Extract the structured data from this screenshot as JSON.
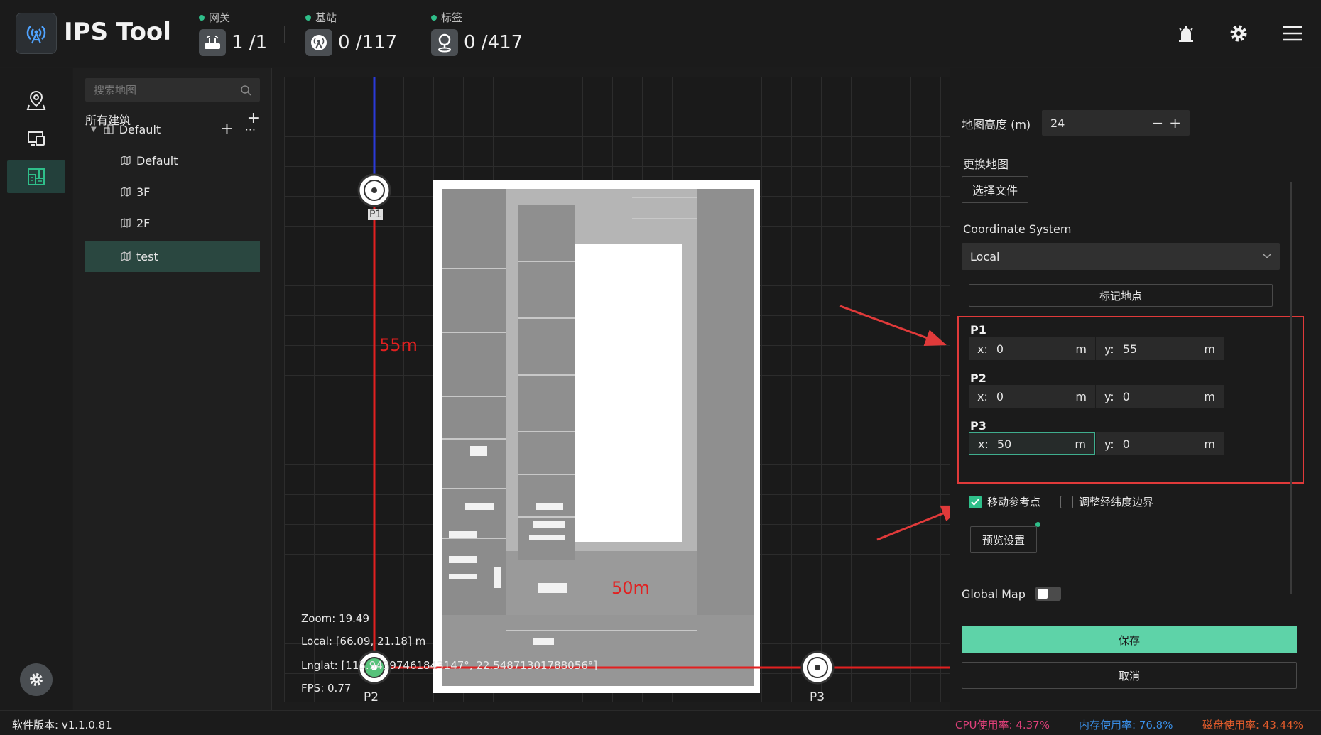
{
  "app": {
    "title": "IPS Tool"
  },
  "stats": [
    {
      "label": "网关",
      "value": "1 /1"
    },
    {
      "label": "基站",
      "value": "0 /117"
    },
    {
      "label": "标签",
      "value": "0 /417"
    }
  ],
  "tree": {
    "search_placeholder": "搜索地图",
    "header": "所有建筑",
    "building": "Default",
    "floors": [
      "Default",
      "3F",
      "2F",
      "test"
    ]
  },
  "map": {
    "labels": {
      "p1": "P1",
      "p2": "P2",
      "p3": "P3",
      "dim_y": "55m",
      "dim_x": "50m"
    },
    "info": {
      "zoom": "Zoom:  19.49",
      "local": "Local:  [66.09, 21.18] m",
      "lnglat": "Lnglat:  [113.94397461843147°, 22.54871301788056°]",
      "fps": "FPS:  0.77"
    }
  },
  "panel": {
    "map_height_label": "地图高度 (m)",
    "map_height_value": "24",
    "change_map_label": "更换地图",
    "choose_file": "选择文件",
    "coord_label": "Coordinate System",
    "coord_value": "Local",
    "mark_btn": "标记地点",
    "points": [
      {
        "name": "P1",
        "x": "0",
        "y": "55"
      },
      {
        "name": "P2",
        "x": "0",
        "y": "0"
      },
      {
        "name": "P3",
        "x": "50",
        "y": "0"
      }
    ],
    "x_prefix": "x:",
    "y_prefix": "y:",
    "unit": "m",
    "move_ref": "移动参考点",
    "adjust_bounds": "调整经纬度边界",
    "preview": "预览设置",
    "global_map": "Global Map",
    "save": "保存",
    "cancel": "取消"
  },
  "status": {
    "version": "软件版本: v1.1.0.81",
    "cpu": "CPU使用率: 4.37%",
    "mem": "内存使用率: 76.8%",
    "disk": "磁盘使用率: 43.44%"
  },
  "colors": {
    "accent": "#2fbf8a",
    "save": "#5ed3a8",
    "cpu": "#e0407a",
    "mem": "#3a8ee6",
    "disk": "#e05b2b",
    "annotation": "#e03a3a"
  }
}
